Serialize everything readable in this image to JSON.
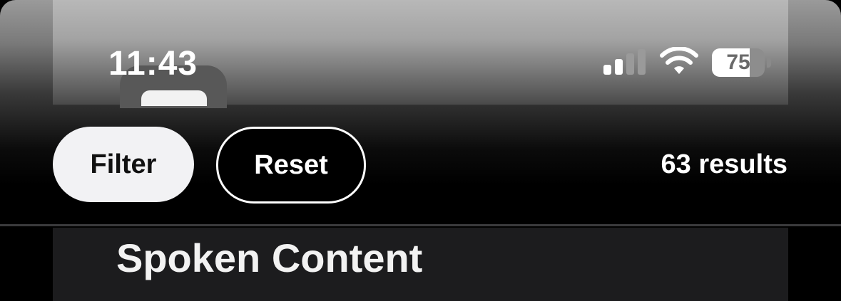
{
  "status_bar": {
    "time": "11:43",
    "battery_level": "75",
    "icons": [
      "cellular-signal-icon",
      "wifi-icon",
      "battery-icon"
    ]
  },
  "toolbar": {
    "filter_label": "Filter",
    "reset_label": "Reset",
    "results_text": "63 results"
  },
  "content": {
    "section_title": "Spoken Content"
  },
  "colors": {
    "background": "#000000",
    "filter_button_bg": "#f2f2f4",
    "panel_bg": "#1c1c1e",
    "divider": "#3a3a3c"
  }
}
